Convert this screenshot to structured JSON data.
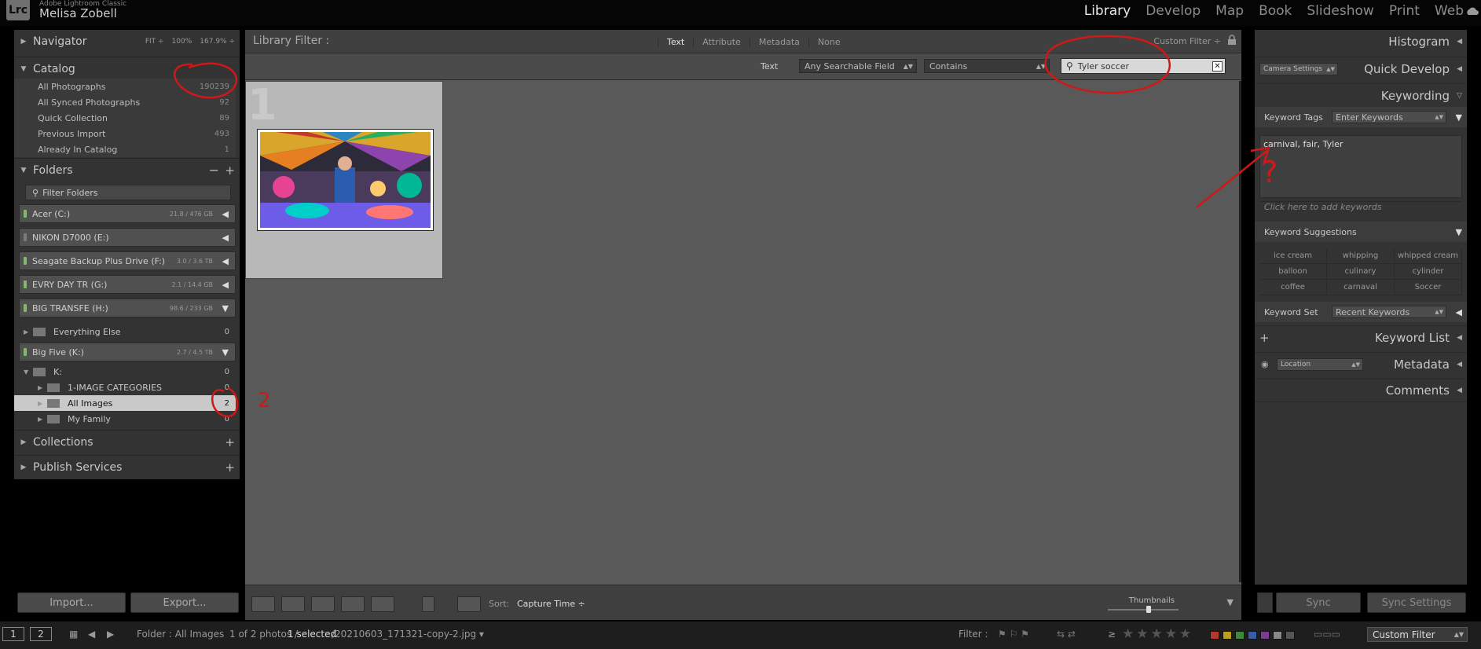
{
  "app": {
    "logo": "Lrc",
    "product": "Adobe Lightroom Classic",
    "user": "Melisa Zobell",
    "modules": [
      "Library",
      "Develop",
      "Map",
      "Book",
      "Slideshow",
      "Print",
      "Web"
    ],
    "active_module": "Library"
  },
  "left": {
    "navigator": {
      "title": "Navigator",
      "options": [
        "FIT ÷",
        "100%",
        "167.9% ÷"
      ]
    },
    "catalog": {
      "title": "Catalog",
      "items": [
        {
          "label": "All Photographs",
          "count": "190239"
        },
        {
          "label": "All Synced Photographs",
          "count": "92"
        },
        {
          "label": "Quick Collection",
          "count": "89"
        },
        {
          "label": "Previous Import",
          "count": "493"
        },
        {
          "label": "Already In Catalog",
          "count": "1"
        }
      ]
    },
    "folders": {
      "title": "Folders",
      "filter_placeholder": "Filter Folders",
      "volumes": [
        {
          "label": "Acer (C:)",
          "size": "21.8 / 476 GB",
          "arrow": "◀",
          "led": "green"
        },
        {
          "label": "NIKON D7000 (E:)",
          "size": "",
          "arrow": "◀",
          "led": "grey"
        },
        {
          "label": "Seagate Backup Plus Drive (F:)",
          "size": "3.0 / 3.6 TB",
          "arrow": "◀",
          "led": "green"
        },
        {
          "label": "EVRY DAY TR (G:)",
          "size": "2.1 / 14.4 GB",
          "arrow": "◀",
          "led": "green"
        },
        {
          "label": "BIG TRANSFE (H:)",
          "size": "98.6 / 233 GB",
          "arrow": "▼",
          "led": "green"
        },
        {
          "label": "Big Five (K:)",
          "size": "2.7 / 4.5 TB",
          "arrow": "▼",
          "led": "green"
        }
      ],
      "everything_else": {
        "label": "Everything Else",
        "count": "0"
      },
      "k_root": {
        "label": "K:",
        "count": "0"
      },
      "subfolders": [
        {
          "label": "1-IMAGE CATEGORIES",
          "count": "0"
        },
        {
          "label": "All Images",
          "count": "2"
        },
        {
          "label": "My Family",
          "count": "0"
        }
      ]
    },
    "collections": {
      "title": "Collections"
    },
    "publish": {
      "title": "Publish Services"
    },
    "import_label": "Import...",
    "export_label": "Export..."
  },
  "filter": {
    "title": "Library Filter :",
    "tabs": [
      "Text",
      "Attribute",
      "Metadata",
      "None"
    ],
    "active_tab": "Text",
    "custom": "Custom Filter ÷",
    "text_label": "Text",
    "field": "Any Searchable Field",
    "rule": "Contains",
    "search": "Tyler soccer"
  },
  "grid": {
    "cell_number": "1"
  },
  "toolbar": {
    "sort_label": "Sort:",
    "sort_value": "Capture Time ÷",
    "thumbnails_label": "Thumbnails"
  },
  "right": {
    "histogram": "Histogram",
    "quick_develop": "Quick Develop",
    "camera_settings": "Camera Settings",
    "keywording": "Keywording",
    "keyword_tags_label": "Keyword Tags",
    "keyword_tags_value": "Enter Keywords",
    "keywords": "carnival, fair, Tyler",
    "add_keywords": "Click here to add keywords",
    "suggestions_label": "Keyword Suggestions",
    "suggestions": [
      "ice cream",
      "whipping",
      "whipped cream",
      "balloon",
      "culinary",
      "cylinder",
      "coffee",
      "carnaval",
      "Soccer"
    ],
    "keyword_set_label": "Keyword Set",
    "keyword_set_value": "Recent Keywords",
    "keyword_list": "Keyword List",
    "metadata": "Metadata",
    "location": "Location",
    "comments": "Comments",
    "sync": "Sync",
    "sync_settings": "Sync Settings"
  },
  "status": {
    "page1": "1",
    "page2": "2",
    "folder": "Folder : All Images",
    "counts": "1 of 2 photos /",
    "selected": "1 selected",
    "filename": "/20210603_171321-copy-2.jpg ▾",
    "filter_label": "Filter :",
    "custom": "Custom Filter",
    "ge": "≥",
    "stars": "★★★★★",
    "swatches": [
      "#b03a2e",
      "#b8a020",
      "#3f8a3a",
      "#3a5ba8",
      "#7a3c8f",
      "#888888",
      "#555555"
    ]
  },
  "annotations": {
    "question": "?",
    "two": "2"
  }
}
